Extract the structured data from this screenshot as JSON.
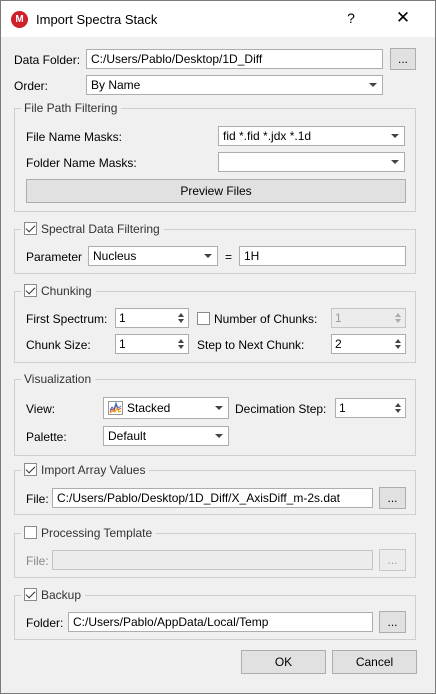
{
  "window": {
    "title": "Import Spectra Stack",
    "help": "?",
    "close": "✕"
  },
  "data_folder": {
    "label": "Data Folder:",
    "value": "C:/Users/Pablo/Desktop/1D_Diff",
    "browse": "..."
  },
  "order": {
    "label": "Order:",
    "value": "By Name"
  },
  "file_path_filtering": {
    "legend": "File Path Filtering",
    "file_name_masks_label": "File Name Masks:",
    "file_name_masks_value": "fid *.fid *.jdx *.1d",
    "folder_name_masks_label": "Folder Name Masks:",
    "folder_name_masks_value": "",
    "preview_button": "Preview Files"
  },
  "spectral_filtering": {
    "legend": "Spectral Data Filtering",
    "parameter_label": "Parameter",
    "parameter_value": "Nucleus",
    "equals": "=",
    "value": "1H"
  },
  "chunking": {
    "legend": "Chunking",
    "first_spectrum_label": "First Spectrum:",
    "first_spectrum_value": "1",
    "number_of_chunks_label": "Number of Chunks:",
    "number_of_chunks_value": "1",
    "chunk_size_label": "Chunk Size:",
    "chunk_size_value": "1",
    "step_label": "Step to Next Chunk:",
    "step_value": "2"
  },
  "visualization": {
    "legend": "Visualization",
    "view_label": "View:",
    "view_value": "Stacked",
    "decimation_label": "Decimation Step:",
    "decimation_value": "1",
    "palette_label": "Palette:",
    "palette_value": "Default"
  },
  "import_array": {
    "legend": "Import Array Values",
    "file_label": "File:",
    "file_value": "C:/Users/Pablo/Desktop/1D_Diff/X_AxisDiff_m-2s.dat",
    "browse": "..."
  },
  "processing_template": {
    "legend": "Processing Template",
    "file_label": "File:",
    "file_value": "",
    "browse": "..."
  },
  "backup": {
    "legend": "Backup",
    "folder_label": "Folder:",
    "folder_value": "C:/Users/Pablo/AppData/Local/Temp",
    "browse": "..."
  },
  "buttons": {
    "ok": "OK",
    "cancel": "Cancel"
  }
}
